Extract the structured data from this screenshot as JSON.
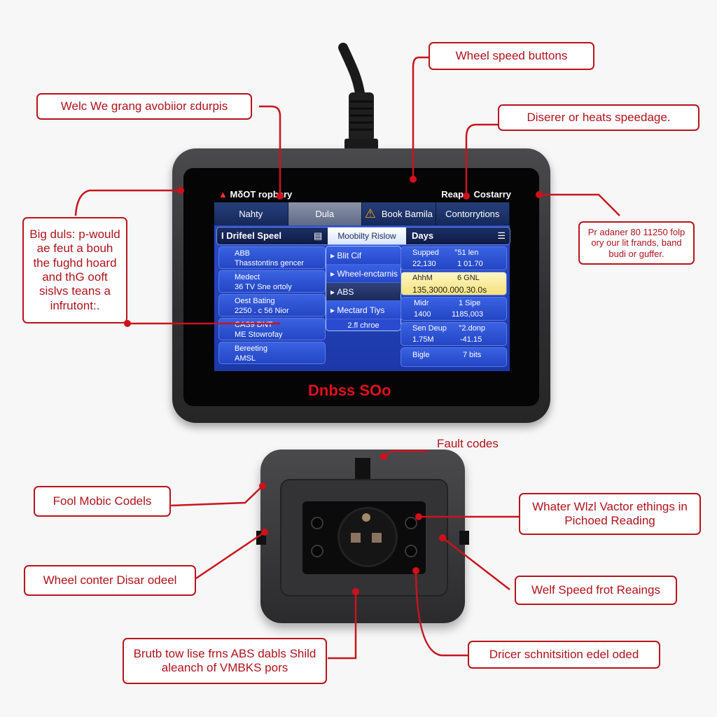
{
  "device_screen": {
    "status_left": "MδOT ropbary",
    "status_right_a": "Reap",
    "status_right_b": "Costarry",
    "tabs": [
      {
        "label": "Nahty",
        "active": false
      },
      {
        "label": "Dula",
        "active": true
      },
      {
        "label": "Book Bamila",
        "active": false,
        "icon": "warning-icon"
      },
      {
        "label": "Contorrytions",
        "active": false
      }
    ],
    "subbar": {
      "left": "I Drifeel Speel",
      "mid": "Moobilty Rislow",
      "right": "Days"
    },
    "left_list": [
      {
        "line1": "ABB",
        "line2": "Thasstontins gencer"
      },
      {
        "line1": "Medect",
        "line2": "36 TV Sne ortoly"
      },
      {
        "line1": "Oest Bating",
        "line2": "2250 . c 56 Nior"
      },
      {
        "line1": "CAS9 DNT",
        "line2": "ME Stowrofay"
      },
      {
        "line1": "Bereeting",
        "line2": "AMSL"
      }
    ],
    "dropdown": {
      "items": [
        "Blit Cif",
        "Wheel-enctarnis",
        "ABS",
        "Mectard Tiys"
      ],
      "selected": "ABS",
      "footer": "2.fl chroe"
    },
    "right_list": [
      {
        "a": "Supped",
        "b": "°51 len",
        "c": "22,130",
        "d": "1 01.70",
        "highlight": false
      },
      {
        "a": "AhhM",
        "b": "6 GNL",
        "c": "135,3000.000.30.0s",
        "d": "",
        "highlight": true
      },
      {
        "a": "Midr",
        "b": "1 Sipe",
        "c": "1400",
        "d": "1185,003",
        "highlight": false
      },
      {
        "a": "Sen Deup",
        "b": "°2.donp",
        "c": "1.75M",
        "d": "-41.15",
        "highlight": false
      },
      {
        "a": "Bigle",
        "b": "7 bits",
        "c": "",
        "d": "",
        "highlight": false
      }
    ],
    "brand": "Dnbss SOo"
  },
  "callouts": {
    "top_left": "Welc We grang avobiior εdurpis",
    "top_right_1": "Wheel speed buttons",
    "top_right_2": "Diserer or heats speedage.",
    "left_mid": "Big duls: p-would ae feut a bouh the fughd hoard and thG ooft sislvs teans a infrutont:.",
    "right_mid": "Pr adaner 80 11250 folp ory our lit frands, band budi or guffer.",
    "fault_codes": "Fault codes",
    "conn_left_1": "Fool Mobic Codels",
    "conn_left_2": "Wheel conter Disar odeel",
    "conn_bottom_left": "Brutb tow lise frns ABS dabls Shild aleanch of VMBKS pors",
    "conn_right_1": "Whater Wlzl Vactor ethings in Pichoed Reading",
    "conn_right_2": "Welf Speed frot Reaings",
    "conn_bottom_right": "Dricer schnitsition edel oded"
  },
  "colors": {
    "accent": "#b8141e",
    "screen_blue": "#2346c4",
    "highlight": "#f5e27a",
    "brand_red": "#e0101e"
  }
}
